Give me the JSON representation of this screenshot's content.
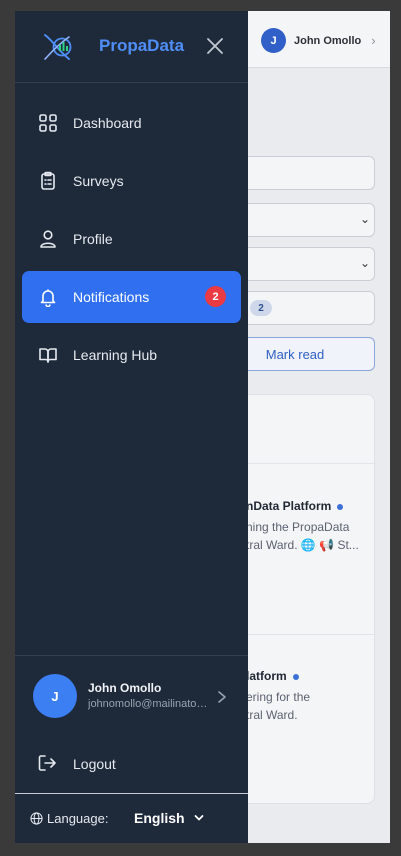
{
  "brand": {
    "name": "PropaData"
  },
  "nav": {
    "items": [
      {
        "label": "Dashboard"
      },
      {
        "label": "Surveys"
      },
      {
        "label": "Profile"
      },
      {
        "label": "Notifications",
        "badge": "2",
        "active": true
      },
      {
        "label": "Learning Hub"
      }
    ]
  },
  "user": {
    "initial": "J",
    "name": "John Omollo",
    "email": "johnomollo@mailinator.com"
  },
  "logout": {
    "label": "Logout"
  },
  "language": {
    "label": "Language:",
    "value": "English"
  },
  "background": {
    "header_user": {
      "initial": "J",
      "name": "John Omollo"
    },
    "filter_count": "2",
    "mark_read_label": "Mark read",
    "notifications": [
      {
        "title": "nData Platform",
        "line1": "ning the PropaData",
        "line2": "tral Ward. 🌐 📢 St..."
      },
      {
        "title": "latform",
        "line1": "ering for the",
        "line2": "tral Ward."
      }
    ]
  },
  "colors": {
    "sidebar_bg": "#1e2939",
    "accent": "#2f6ff0",
    "brand_text": "#4f8ef7",
    "badge": "#ea3b45"
  },
  "icons": {
    "logo": "propadata-logo-icon",
    "close": "close-icon",
    "dashboard": "grid-icon",
    "surveys": "clipboard-icon",
    "profile": "user-icon",
    "notifications": "bell-icon",
    "learning": "book-open-icon",
    "logout": "logout-icon",
    "globe": "globe-icon"
  }
}
